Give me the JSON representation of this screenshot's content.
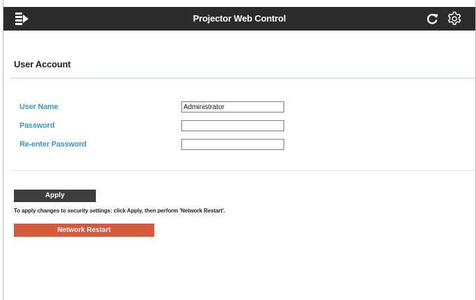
{
  "header": {
    "title": "Projector Web Control",
    "background": "#2b2b2b",
    "icons": {
      "menu": "menu-arrow-icon",
      "refresh": "refresh-icon",
      "settings": "gear-icon"
    }
  },
  "section": {
    "title": "User Account"
  },
  "fields": {
    "user_name": {
      "label": "User Name",
      "value": "Administrator"
    },
    "password": {
      "label": "Password",
      "value": ""
    },
    "reenter_password": {
      "label": "Re-enter Password",
      "value": ""
    }
  },
  "actions": {
    "apply_label": "Apply",
    "note": "To apply changes to security settings: click Apply, then perform 'Network Restart'.",
    "restart_label": "Network Restart"
  },
  "colors": {
    "label": "#3a9ac4",
    "apply_button": "#3e3e3e",
    "restart_button": "#d35a3b",
    "section_rule": "#a9d4e4"
  }
}
